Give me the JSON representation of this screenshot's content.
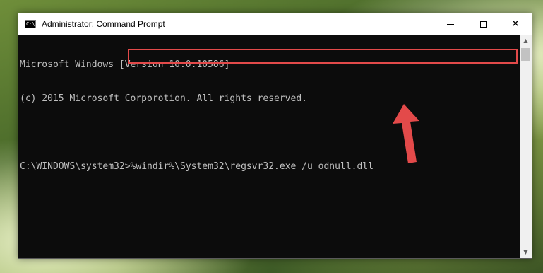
{
  "window": {
    "title": "Administrator: Command Prompt",
    "app_icon_text": "C:\\"
  },
  "controls": {
    "minimize": "minimize",
    "maximize": "maximize",
    "close": "✕"
  },
  "console": {
    "lines": [
      "Microsoft Windows [Version 10.0.10586]",
      "(c) 2015 Microsoft Corporotion. All rights reserved."
    ],
    "prompt": "C:\\WINDOWS\\system32>",
    "command": "%windir%\\System32\\regsvr32.exe /u odnull.dll"
  },
  "annotation": {
    "highlight_color": "#e34a4a",
    "arrow_color": "#e34a4a"
  },
  "scrollbar": {
    "up_icon": "▲",
    "down_icon": "▼"
  }
}
